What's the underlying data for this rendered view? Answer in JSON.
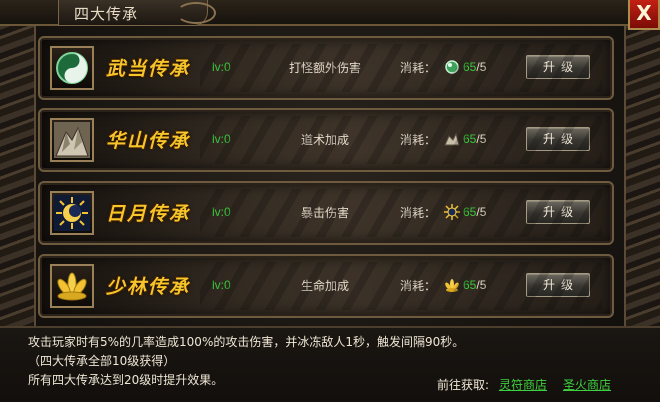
{
  "window": {
    "title": "四大传承",
    "close_label": "X"
  },
  "rows": [
    {
      "name": "武当传承",
      "level": "lv:0",
      "effect": "打怪额外伤害",
      "cost_label": "消耗：",
      "cost_current": "65",
      "cost_sep": "/5",
      "button": "升级",
      "icon": "yin-yang-jade-icon",
      "cost_icon": "jade-orb-icon"
    },
    {
      "name": "华山传承",
      "level": "lv:0",
      "effect": "道术加成",
      "cost_label": "消耗：",
      "cost_current": "65",
      "cost_sep": "/5",
      "button": "升级",
      "icon": "mountain-icon",
      "cost_icon": "rock-icon"
    },
    {
      "name": "日月传承",
      "level": "lv:0",
      "effect": "暴击伤害",
      "cost_label": "消耗：",
      "cost_current": "65",
      "cost_sep": "/5",
      "button": "升级",
      "icon": "sun-moon-icon",
      "cost_icon": "sun-icon"
    },
    {
      "name": "少林传承",
      "level": "lv:0",
      "effect": "生命加成",
      "cost_label": "消耗：",
      "cost_current": "65",
      "cost_sep": "/5",
      "button": "升级",
      "icon": "golden-lotus-icon",
      "cost_icon": "lotus-icon"
    }
  ],
  "info": {
    "line1": "攻击玩家时有5%的几率造成100%的攻击伤害，并冰冻敌人1秒，触发间隔90秒。",
    "line2": "（四大传承全部10级获得）",
    "line3": "所有四大传承达到20级时提升效果。",
    "goto_label": "前往获取:",
    "shop1": "灵符商店",
    "shop2": "圣火商店"
  },
  "colors": {
    "name_gold": "#f7c52a",
    "level_green": "#39c63a",
    "link_green": "#3fd23f",
    "close_red": "#c22014"
  }
}
